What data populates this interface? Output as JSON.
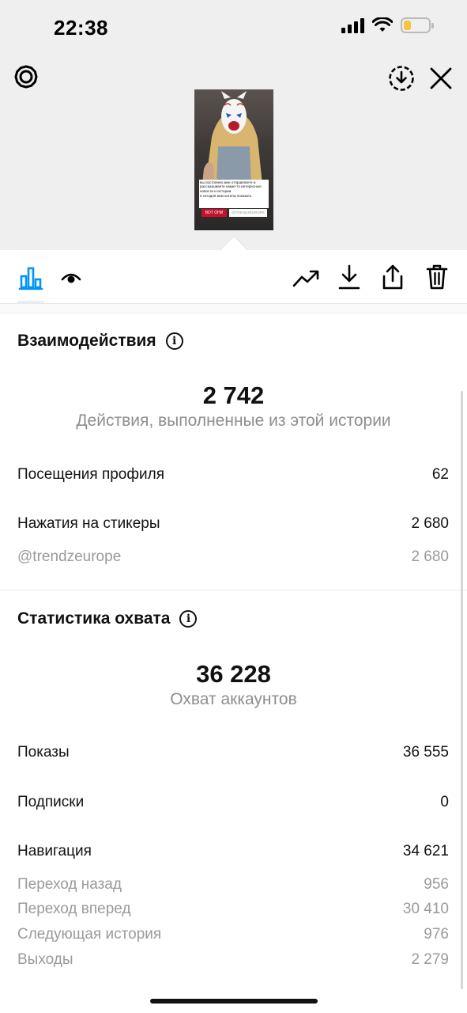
{
  "status_bar": {
    "time": "22:38"
  },
  "story_thumbnail": {
    "caption_text": "вы постоянно мне отправляете и рассказываете какие-то интересные новости и истории",
    "highlight_text": "я сегодня вам хотела показать",
    "button_text": "вот они",
    "sticker_text": "@TRENDZEUROPE"
  },
  "interactions": {
    "title": "Взаимодействия",
    "total": "2 742",
    "caption": "Действия, выполненные из этой истории",
    "rows": [
      {
        "label": "Посещения профиля",
        "value": "62"
      },
      {
        "label": "Нажатия на стикеры",
        "value": "2 680"
      }
    ],
    "sub_rows": [
      {
        "label": "@trendzeurope",
        "value": "2 680"
      }
    ]
  },
  "reach": {
    "title": "Статистика охвата",
    "total": "36 228",
    "caption": "Охват аккаунтов",
    "rows": [
      {
        "label": "Показы",
        "value": "36 555"
      },
      {
        "label": "Подписки",
        "value": "0"
      },
      {
        "label": "Навигация",
        "value": "34 621"
      }
    ],
    "sub_rows": [
      {
        "label": "Переход назад",
        "value": "956"
      },
      {
        "label": "Переход вперед",
        "value": "30 410"
      },
      {
        "label": "Следующая история",
        "value": "976"
      },
      {
        "label": "Выходы",
        "value": "2 279"
      }
    ]
  },
  "icons": {
    "settings": "gear-icon",
    "download_circle": "download-circle-icon",
    "close": "close-icon",
    "insights_tab": "bar-chart-icon",
    "viewers_tab": "eye-icon",
    "promote": "trending-up-icon",
    "save": "download-icon",
    "share": "share-icon",
    "delete": "trash-icon",
    "info": "info-icon"
  },
  "colors": {
    "accent": "#0095f6",
    "battery": "#f6c343"
  }
}
